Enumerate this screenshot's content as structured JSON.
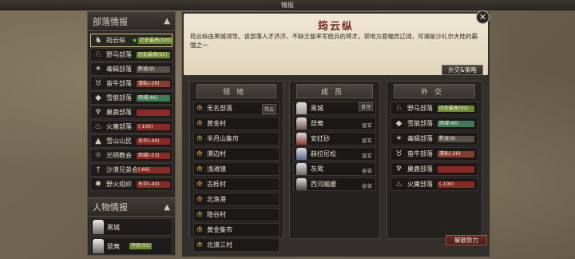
{
  "topbar": {
    "title": "情报"
  },
  "left": {
    "tribes_header": "部落情报",
    "tribes": [
      {
        "name": "筠云纵",
        "star": "★",
        "badge": "历史最高(100)",
        "color": "#6c8a2e",
        "active": true,
        "icon": "warrior-icon"
      },
      {
        "name": "野马部落",
        "badge": "历史最高(92)",
        "color": "#6c8a2e",
        "icon": "horse-icon"
      },
      {
        "name": "毒蝎部落",
        "badge": "黔凌(9)",
        "color": "#555048",
        "icon": "scorpion-icon"
      },
      {
        "name": "蛮牛部落",
        "badge": "清私(-26)",
        "color": "#8b3a2f",
        "icon": "bull-icon"
      },
      {
        "name": "雪狼部落",
        "badge": "西域(46)",
        "color": "#3f7a5a",
        "icon": "wolf-icon"
      },
      {
        "name": "巢鹿部落",
        "badge": "",
        "color": "#8b2a25",
        "icon": "deer-icon"
      },
      {
        "name": "火魔部落",
        "badge": "(-100)",
        "color": "#8b2a25",
        "icon": "flame-icon"
      },
      {
        "name": "雪山山民",
        "badge": "东华(-40)",
        "color": "#8b2a25",
        "icon": "mountain-icon"
      },
      {
        "name": "光明教会",
        "badge": "西域(-53)",
        "color": "#8b2a25",
        "icon": "sun-icon"
      },
      {
        "name": "沙漠兄弟会",
        "badge": "(-66)",
        "color": "#8b2a25",
        "icon": "dagger-icon"
      },
      {
        "name": "野火组织",
        "badge": "东华(-40)",
        "color": "#8b2a25",
        "icon": "fire-icon"
      }
    ],
    "people_header": "人物情报",
    "people": [
      {
        "name": "黑城",
        "badge": ""
      },
      {
        "name": "琵鸯",
        "badge": "平民(91)"
      }
    ]
  },
  "dialog": {
    "title": "筠云纵",
    "description": "筠云纵由黑城领导。该部落人才济济，不缺乏能率军统兵的将才。领地方面幅员辽阔，可谓是沙扎尔大陆的霸强之一",
    "diplomacy_button": "外交&策略",
    "territory": {
      "header": "领地",
      "tag": "筠云",
      "items": [
        "无名部落",
        "黄金村",
        "半月山集市",
        "漠边村",
        "浅滩镇",
        "古栎村",
        "北渔港",
        "隐谷村",
        "黄金集市",
        "北漠三村"
      ]
    },
    "members": {
      "header": "成员",
      "items": [
        {
          "name": "黑城",
          "role": "",
          "tag": "首领",
          "avatar": "#9a9a9a"
        },
        {
          "name": "琵鸯",
          "role": "督军",
          "avatar": "#7a5a4a"
        },
        {
          "name": "安红砂",
          "role": "督军",
          "avatar": "#8a3a2a"
        },
        {
          "name": "赫拉尼松",
          "role": "督军",
          "avatar": "#5a6a8a"
        },
        {
          "name": "灰鸳",
          "role": "参将",
          "avatar": "#6a6a6a"
        },
        {
          "name": "西河媚媛",
          "role": "参将",
          "avatar": "#4a4a4a"
        }
      ]
    },
    "diplomacy": {
      "header": "外交",
      "items": [
        {
          "name": "野马部落",
          "badge": "历史最高(92)",
          "color": "#6c8a2e",
          "icon": "horse-icon"
        },
        {
          "name": "雪狼部落",
          "badge": "西域(46)",
          "color": "#3f7a5a",
          "icon": "wolf-icon"
        },
        {
          "name": "毒蝎部落",
          "badge": "黔凌(9)",
          "color": "#555048",
          "icon": "scorpion-icon"
        },
        {
          "name": "蛮牛部落",
          "badge": "清私(-26)",
          "color": "#8b3a2f",
          "icon": "bull-icon"
        },
        {
          "name": "巢鹿部落",
          "badge": "",
          "color": "#8b2a25",
          "icon": "deer-icon"
        },
        {
          "name": "火魔部落",
          "badge": "(-100)",
          "color": "#8b2a25",
          "icon": "flame-icon"
        }
      ]
    },
    "release_button": "解散势力"
  }
}
